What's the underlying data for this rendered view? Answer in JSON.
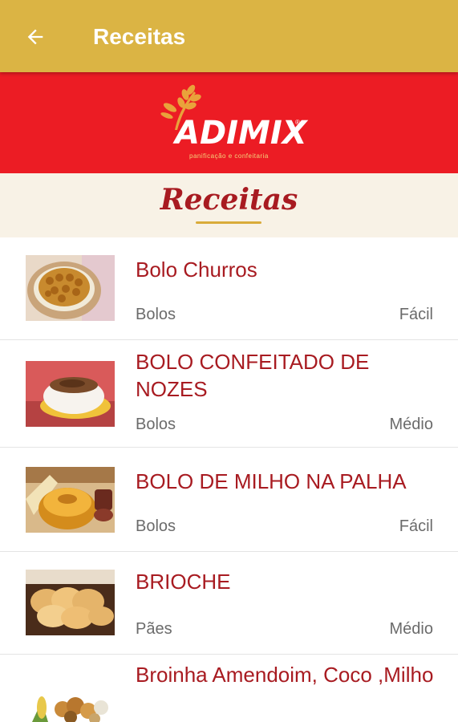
{
  "appbar": {
    "title": "Receitas",
    "back_icon": "arrow-left-icon",
    "background": "#dbb444"
  },
  "brand": {
    "logo_text": "ADIMIX",
    "registered": "®",
    "tagline": "panificação e confeitaria",
    "background": "#ec1c24"
  },
  "section": {
    "title": "Receitas"
  },
  "recipes": [
    {
      "name": "Bolo Churros",
      "category": "Bolos",
      "difficulty": "Fácil"
    },
    {
      "name": "BOLO CONFEITADO DE NOZES",
      "category": "Bolos",
      "difficulty": "Médio"
    },
    {
      "name": "BOLO DE MILHO NA PALHA",
      "category": "Bolos",
      "difficulty": "Fácil"
    },
    {
      "name": "BRIOCHE",
      "category": "Pães",
      "difficulty": "Médio"
    },
    {
      "name": "Broinha  Amendoim, Coco ,Milho",
      "category": "",
      "difficulty": ""
    }
  ],
  "colors": {
    "accent_red": "#a81b21",
    "gold": "#d9ab3a",
    "meta_gray": "#6b6b6b"
  }
}
